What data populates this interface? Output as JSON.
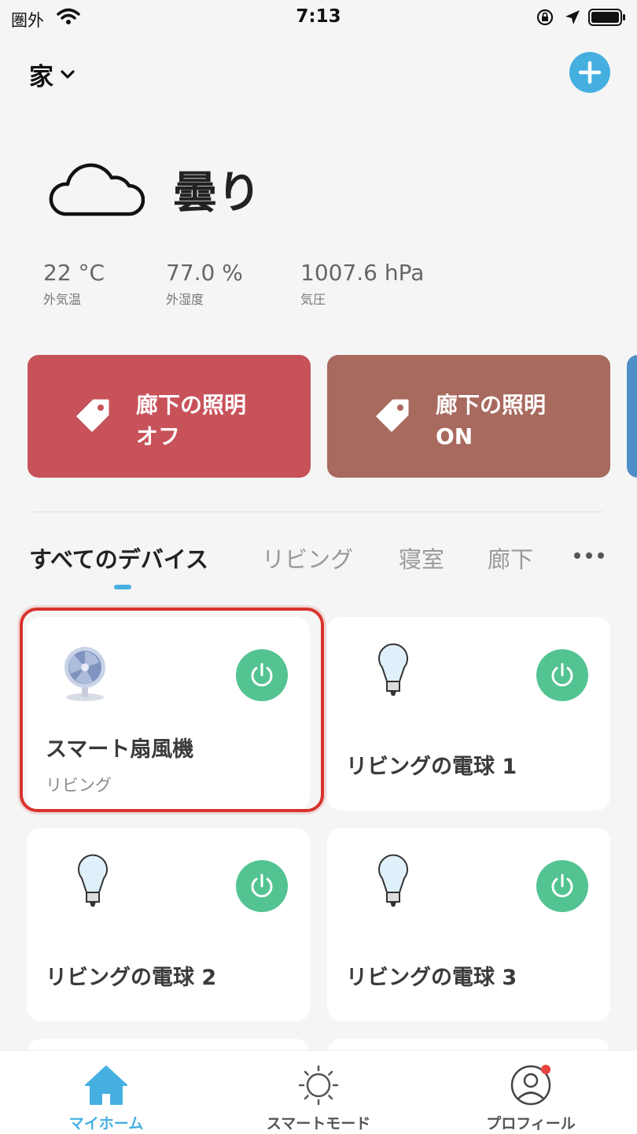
{
  "status_bar": {
    "carrier": "圏外",
    "time": "7:13"
  },
  "header": {
    "home_name": "家"
  },
  "weather": {
    "condition": "曇り",
    "stats": [
      {
        "value": "22 °C",
        "label": "外気温"
      },
      {
        "value": "77.0 %",
        "label": "外湿度"
      },
      {
        "value": "1007.6 hPa",
        "label": "気圧"
      }
    ]
  },
  "scenes": [
    {
      "line1": "廊下の照明",
      "line2": "オフ",
      "color": "#c8525a"
    },
    {
      "line1": "廊下の照明",
      "line2": "ON",
      "color": "#a8695e"
    }
  ],
  "tabs": [
    {
      "label": "すべてのデバイス",
      "active": true
    },
    {
      "label": "リビング"
    },
    {
      "label": "寝室"
    },
    {
      "label": "廊下"
    }
  ],
  "devices": [
    {
      "name": "スマート扇風機",
      "room": "リビング",
      "icon": "fan-icon"
    },
    {
      "name": "リビングの電球 1",
      "icon": "bulb-icon"
    },
    {
      "name": "リビングの電球 2",
      "icon": "bulb-icon"
    },
    {
      "name": "リビングの電球 3",
      "icon": "bulb-icon"
    }
  ],
  "bottom_nav": [
    {
      "label": "マイホーム",
      "active": true
    },
    {
      "label": "スマートモード"
    },
    {
      "label": "プロフィール"
    }
  ],
  "colors": {
    "accent": "#45b0e0",
    "power_on": "#53c392",
    "highlight": "#d8332c",
    "notification": "#e8433f"
  }
}
